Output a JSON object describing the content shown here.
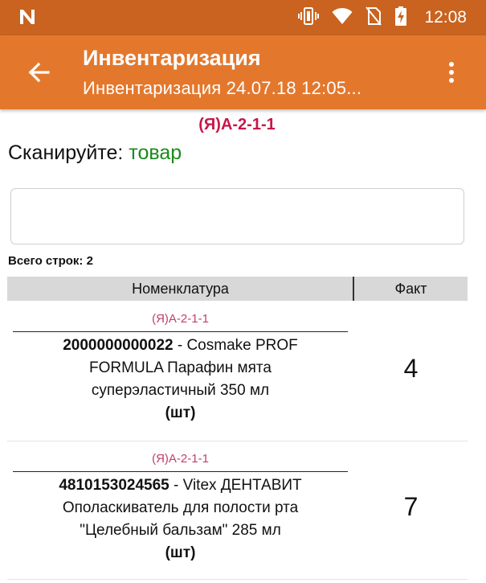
{
  "status_bar": {
    "time": "12:08",
    "icons": [
      "n-logo-icon",
      "vibrate-icon",
      "wifi-icon",
      "no-sim-icon",
      "battery-charging-icon"
    ]
  },
  "app_bar": {
    "title": "Инвентаризация",
    "subtitle": "Инвентаризация 24.07.18 12:05...",
    "back_icon": "arrow-back-icon",
    "menu_icon": "more-vert-icon"
  },
  "location": "(Я)А-2-1-1",
  "scan": {
    "prompt": "Сканируйте: ",
    "target": "товар",
    "input_value": "",
    "input_placeholder": ""
  },
  "rows_count": "Всего строк: 2",
  "table": {
    "headers": [
      "Номенклатура",
      "Факт"
    ],
    "rows": [
      {
        "location": "(Я)А-2-1-1",
        "barcode": "2000000000022",
        "line1_rest": " - Cosmake PROF",
        "line2": "FORMULA Парафин мята",
        "line3": "суперэластичный 350 мл",
        "unit": "(шт)",
        "fact": "4"
      },
      {
        "location": "(Я)А-2-1-1",
        "barcode": "4810153024565",
        "line1_rest": " - Vitex ДЕНТАВИТ",
        "line2": "Ополаскиватель для полости рта",
        "line3": "\"Целебный бальзам\" 285 мл",
        "unit": "(шт)",
        "fact": "7"
      }
    ]
  },
  "colors": {
    "status_bar": "#c9631f",
    "app_bar": "#e3782d",
    "location_accent": "#c8174a",
    "scan_target": "#1a8a1a",
    "row_location": "#c0406a",
    "table_header_bg": "#d8d8d8"
  }
}
